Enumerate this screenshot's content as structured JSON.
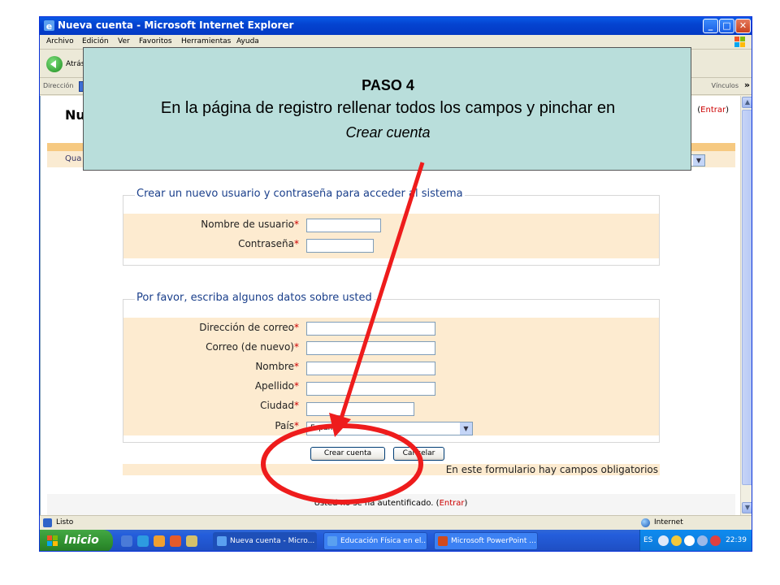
{
  "window": {
    "title": "Nueva cuenta - Microsoft Internet Explorer",
    "min_label": "_",
    "max_label": "□",
    "close_label": "✕"
  },
  "menu": [
    "Archivo",
    "Edición",
    "Ver",
    "Favoritos",
    "Herramientas",
    "Ayuda"
  ],
  "toolbar": {
    "back_label": "Atrás"
  },
  "addressbar": {
    "label": "Dirección",
    "links_label": "Vínculos",
    "chevron": "»"
  },
  "page": {
    "heading": "Nu",
    "login_top_suffix": "Entrar",
    "nav_partial": "Qua",
    "section1_legend": "Crear un nuevo usuario y contraseña para acceder al sistema",
    "section2_legend": "Por favor, escriba algunos datos sobre usted",
    "fields1": [
      {
        "label": "Nombre de usuario"
      },
      {
        "label": "Contraseña"
      }
    ],
    "fields2": [
      {
        "label": "Dirección de correo"
      },
      {
        "label": "Correo (de nuevo)"
      },
      {
        "label": "Nombre"
      },
      {
        "label": "Apellido"
      },
      {
        "label": "Ciudad"
      },
      {
        "label": "País",
        "value": "España"
      }
    ],
    "required_marker": "*",
    "create_button": "Crear cuenta",
    "cancel_button": "Cancelar",
    "required_note": "En este formulario hay campos obligatorios",
    "footer_text": "Usted no se ha autentificado.",
    "footer_link": "Entrar"
  },
  "statusbar": {
    "text": "Listo",
    "zone": "Internet"
  },
  "taskbar": {
    "start_label": "Inicio",
    "tasks": [
      "Nueva cuenta - Micro...",
      "Educación Física en el...",
      "Microsoft PowerPoint ..."
    ],
    "tray_lang": "ES",
    "clock": "22:39"
  },
  "callout": {
    "title": "PASO 4",
    "line1": "En la página de registro rellenar todos los campos y pinchar en",
    "line2": "Crear cuenta"
  },
  "colors": {
    "annotation_red": "#ee1c1c",
    "callout_bg": "#b9dedb",
    "field_band": "#fdebd0",
    "legend_blue": "#1a3f8b"
  }
}
